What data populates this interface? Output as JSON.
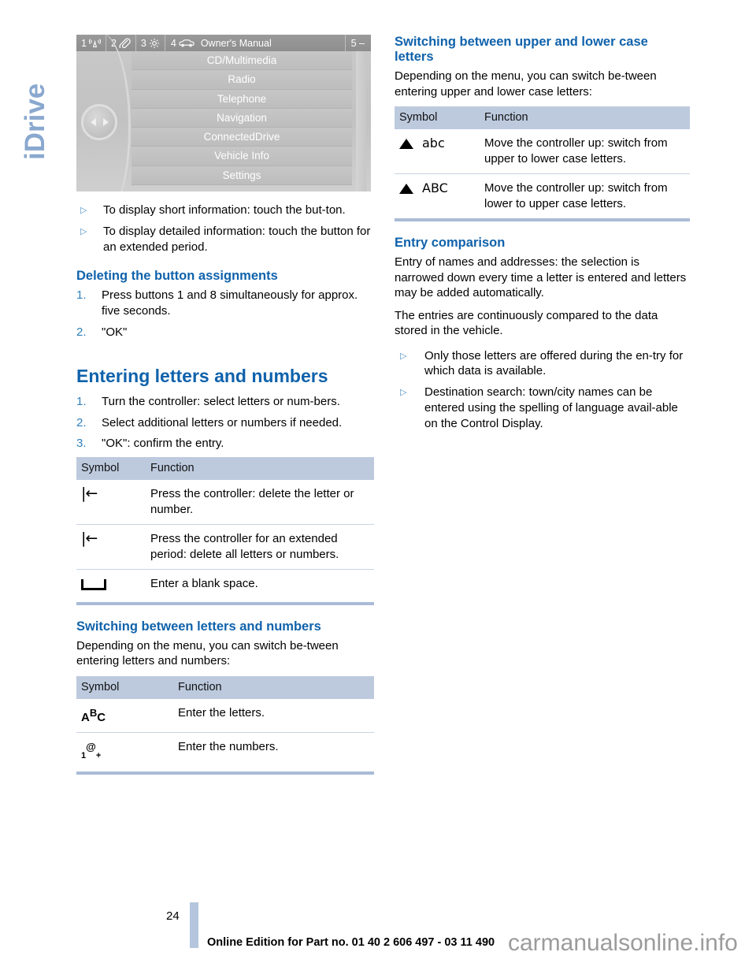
{
  "chapter_tab": {
    "label": "iDrive"
  },
  "idrive_screen": {
    "status_bar": [
      {
        "num": "1",
        "icon": "antenna-signal-icon"
      },
      {
        "num": "2",
        "icon": "link-paperclip-icon"
      },
      {
        "num": "3",
        "icon": "gear-icon"
      },
      {
        "num": "4",
        "icon": "car-icon",
        "title": "Owner's Manual"
      },
      {
        "num": "5",
        "icon": "dash-icon",
        "trailing": "–"
      }
    ],
    "title": "Owner's Manual",
    "last_cell": "5 –",
    "menu_items": [
      "CD/Multimedia",
      "Radio",
      "Telephone",
      "Navigation",
      "ConnectedDrive",
      "Vehicle Info",
      "Settings"
    ]
  },
  "left": {
    "intro_bullets": [
      "To display short information: touch the but-ton.",
      "To display detailed information: touch the button for an extended period."
    ],
    "deleting": {
      "heading": "Deleting the button assignments",
      "steps": [
        {
          "num": "1.",
          "text": "Press buttons 1 and 8 simultaneously for approx. five seconds."
        },
        {
          "num": "2.",
          "text": "\"OK\""
        }
      ]
    },
    "entering": {
      "heading": "Entering letters and numbers",
      "steps": [
        {
          "num": "1.",
          "text": "Turn the controller: select letters or num-bers."
        },
        {
          "num": "2.",
          "text": "Select additional letters or numbers if needed."
        },
        {
          "num": "3.",
          "text": "\"OK\": confirm the entry."
        }
      ]
    },
    "table_entry": {
      "columns": [
        "Symbol",
        "Function"
      ],
      "rows": [
        {
          "symbol": "backspace",
          "function": "Press the controller: delete the letter or number."
        },
        {
          "symbol": "backspace",
          "function": "Press the controller for an extended period: delete all letters or numbers."
        },
        {
          "symbol": "blank-space",
          "function": "Enter a blank space."
        }
      ]
    },
    "switching_letters_numbers": {
      "heading": "Switching between letters and numbers",
      "paragraph": "Depending on the menu, you can switch be-tween entering letters and numbers:",
      "columns": [
        "Symbol",
        "Function"
      ],
      "rows": [
        {
          "symbol_main": "A",
          "symbol_sup": "B",
          "symbol_tail": "C",
          "function": "Enter the letters."
        },
        {
          "symbol_main": "1",
          "symbol_sup": "@",
          "symbol_tail": "+",
          "function": "Enter the numbers."
        }
      ]
    }
  },
  "right": {
    "switching_case": {
      "heading": "Switching between upper and lower case letters",
      "paragraph": "Depending on the menu, you can switch be-tween entering upper and lower case letters:",
      "columns": [
        "Symbol",
        "Function"
      ],
      "rows": [
        {
          "symbol_icon": "triangle-up-icon",
          "symbol_text": "abc",
          "function": "Move the controller up: switch from upper to lower case letters."
        },
        {
          "symbol_icon": "triangle-up-icon",
          "symbol_text": "ABC",
          "function": "Move the controller up: switch from lower to upper case letters."
        }
      ]
    },
    "entry_comparison": {
      "heading": "Entry comparison",
      "paragraphs": [
        "Entry of names and addresses: the selection is narrowed down every time a letter is entered and letters may be added automatically.",
        "The entries are continuously compared to the data stored in the vehicle."
      ],
      "bullets": [
        "Only those letters are offered during the en-try for which data is available.",
        "Destination search: town/city names can be entered using the spelling of language avail-able on the Control Display."
      ]
    }
  },
  "footer": {
    "page_number": "24",
    "edition_line": "Online Edition for Part no. 01 40 2 606 497 - 03 11 490",
    "watermark": "carmanualsonline.info"
  },
  "colors": {
    "heading_blue": "#0f62ab",
    "tab_blue": "#8aa8cf",
    "table_header_bg": "#bdcade",
    "table_rule": "#c7d3e3",
    "table_bottom": "#a9bbd6"
  }
}
